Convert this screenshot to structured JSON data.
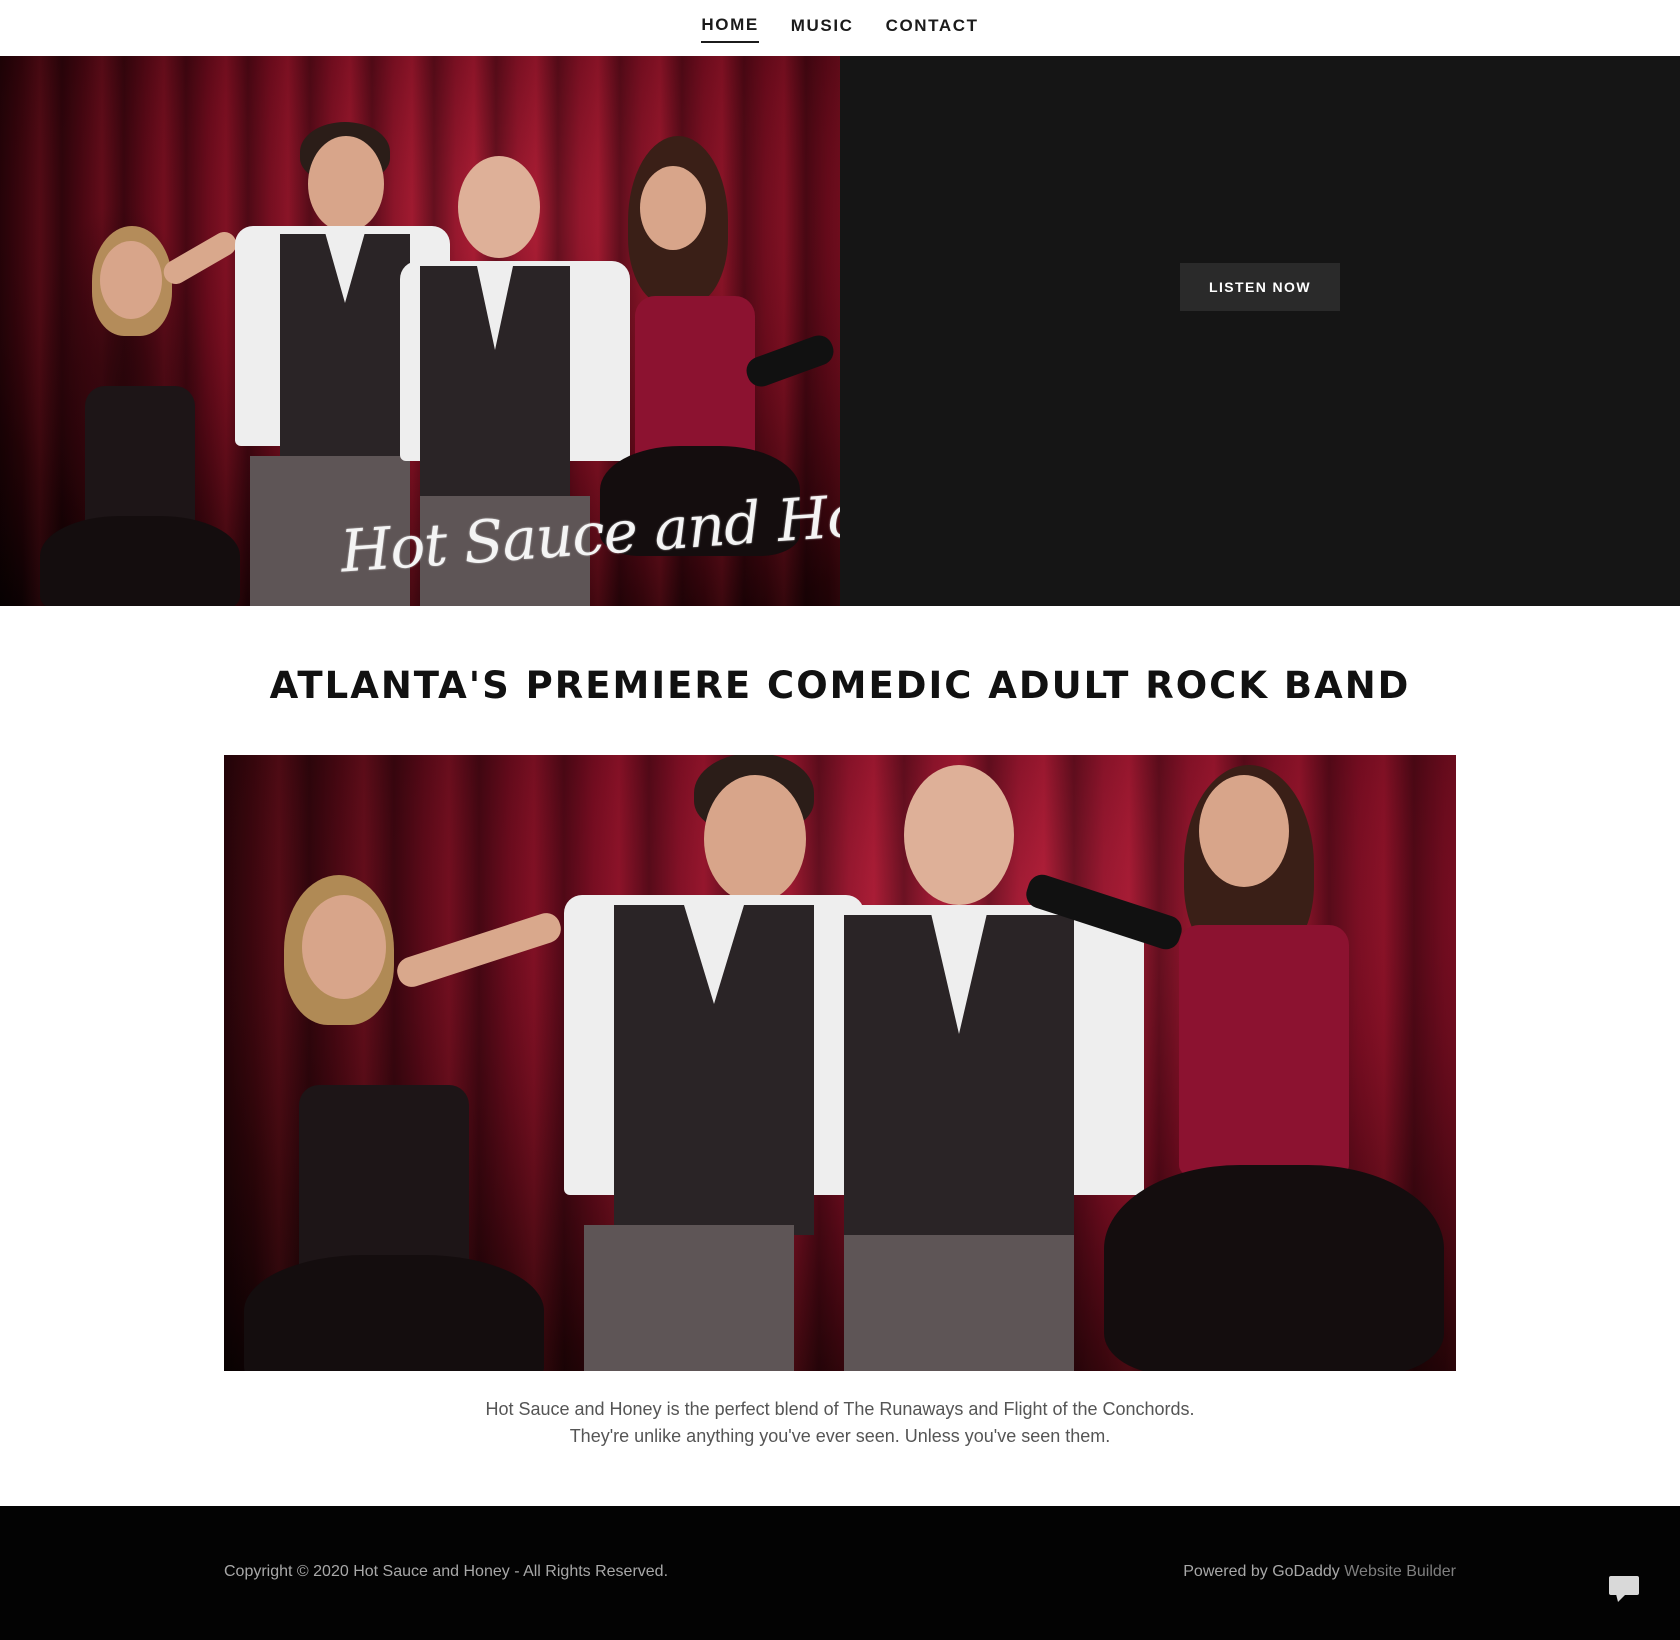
{
  "nav": {
    "items": [
      {
        "label": "HOME",
        "active": true
      },
      {
        "label": "MUSIC",
        "active": false
      },
      {
        "label": "CONTACT",
        "active": false
      }
    ]
  },
  "hero": {
    "logo_text": "Hot Sauce and Honey",
    "cta_label": "LISTEN NOW"
  },
  "main": {
    "headline": "ATLANTA'S PREMIERE COMEDIC ADULT ROCK BAND",
    "description_line1": "Hot Sauce and Honey is the perfect blend of The Runaways and Flight of the Conchords.",
    "description_line2": "They're unlike anything you've ever seen. Unless you've seen them."
  },
  "footer": {
    "copyright": "Copyright © 2020 Hot Sauce and Honey - All Rights Reserved.",
    "powered_prefix": "Powered by GoDaddy",
    "powered_link": "Website Builder",
    "chat_icon": "chat-bubble-icon"
  },
  "colors": {
    "accent_dark": "#151515",
    "button_bg": "#2a2a2a",
    "curtain_red": "#a81c34",
    "footer_bg": "#030303"
  }
}
